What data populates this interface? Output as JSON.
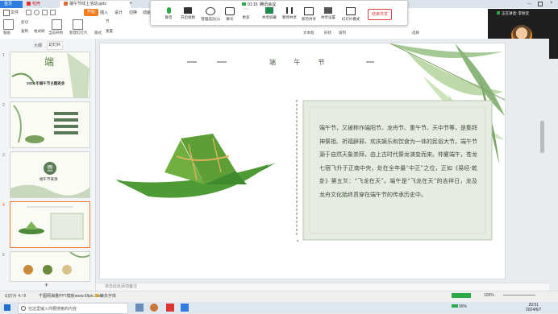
{
  "tabs": {
    "home": "首页",
    "shell": "稻壳",
    "doc": "端午节线上活动.pptx"
  },
  "menu": {
    "file": "文件",
    "start": "开始",
    "insert": "插入",
    "design": "设计",
    "switch": "切换",
    "animate": "动画"
  },
  "ribbon": {
    "paste": "粘贴",
    "format_brush": "格式刷",
    "cut": "剪切",
    "copy": "复制",
    "current_start": "当前开始",
    "new_slide": "新建幻灯片",
    "layout": "版式",
    "section": "节",
    "reset": "重置",
    "textbox": "文本框",
    "shape": "形状",
    "arrange": "排列",
    "select": "选择"
  },
  "meeting": {
    "time": "01:15",
    "meeting_name": "腾讯会议",
    "buttons": [
      "静音",
      "开启视频",
      "管理成员(1)",
      "聊天",
      "更多",
      "共享屏幕",
      "暂停共享",
      "新的共享",
      "共享设置",
      "幻灯片模式"
    ],
    "end": "结束共享",
    "video_title": "正在讲话: 李秋莹",
    "video_name": "李秋莹(我)"
  },
  "panel": {
    "outline": "大纲",
    "slides": "幻灯片",
    "thumbs": [
      {
        "num": "1",
        "text": "2024 年端午节主题班会"
      },
      {
        "num": "2",
        "text": ""
      },
      {
        "num": "3",
        "text": "端午节来源"
      },
      {
        "num": "4",
        "text": ""
      },
      {
        "num": "5",
        "text": ""
      }
    ],
    "add": "+"
  },
  "slide": {
    "title": "端      午      节",
    "body": "端午节，又被称作端阳节、龙舟节、重午节、天中节等，是集拜神祭祖、祈福辟邪、欢庆娱乐和饮食为一体的民俗大节。端午节源于自然天象崇拜，由上古时代祭龙演变而来。仲夏端午，苍龙七宿飞升于正南中央，处在全年最“中正”之位，正如《易经·乾卦》第五爻：“飞龙在天”。端午是“飞龙在天”的吉祥日，龙及龙舟文化始终贯穿在端午节的传承历史中。"
  },
  "notes": "单击此处添加备注",
  "status": {
    "slide": "幻灯片 4 / 8",
    "theme": "千图网海量PPT模板www.58pic.com",
    "font_missing": "缺失字体",
    "zoom": "106%"
  },
  "taskbar": {
    "search_placeholder": "在这里输入你要搜索的内容",
    "time": "20:51",
    "date": "2024/6/7",
    "battery": "99%"
  },
  "colors": {
    "accent": "#2f7de1",
    "wps_orange": "#f47d20",
    "slide_green": "#5a7a55",
    "panel_bg": "#e6ece1"
  }
}
